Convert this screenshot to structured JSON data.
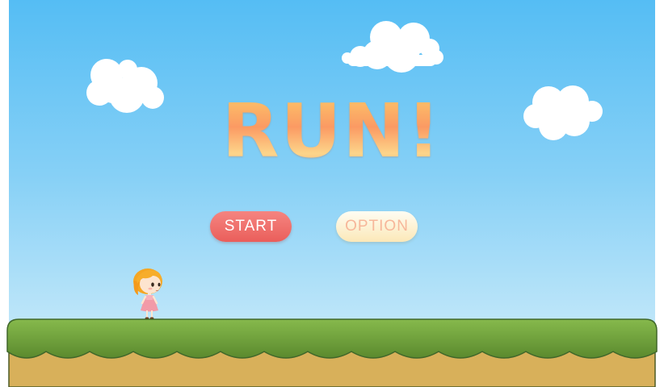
{
  "game": {
    "title": "RUN!",
    "buttons": {
      "start_label": "START",
      "option_label": "OPTION"
    }
  },
  "colors": {
    "sky_top": "#55bdf4",
    "sky_bottom": "#d3eefb",
    "start_button": "#ea5e5b",
    "option_button": "#fbe8b8",
    "grass": "#6b9a3a",
    "dirt": "#d8b05a"
  }
}
